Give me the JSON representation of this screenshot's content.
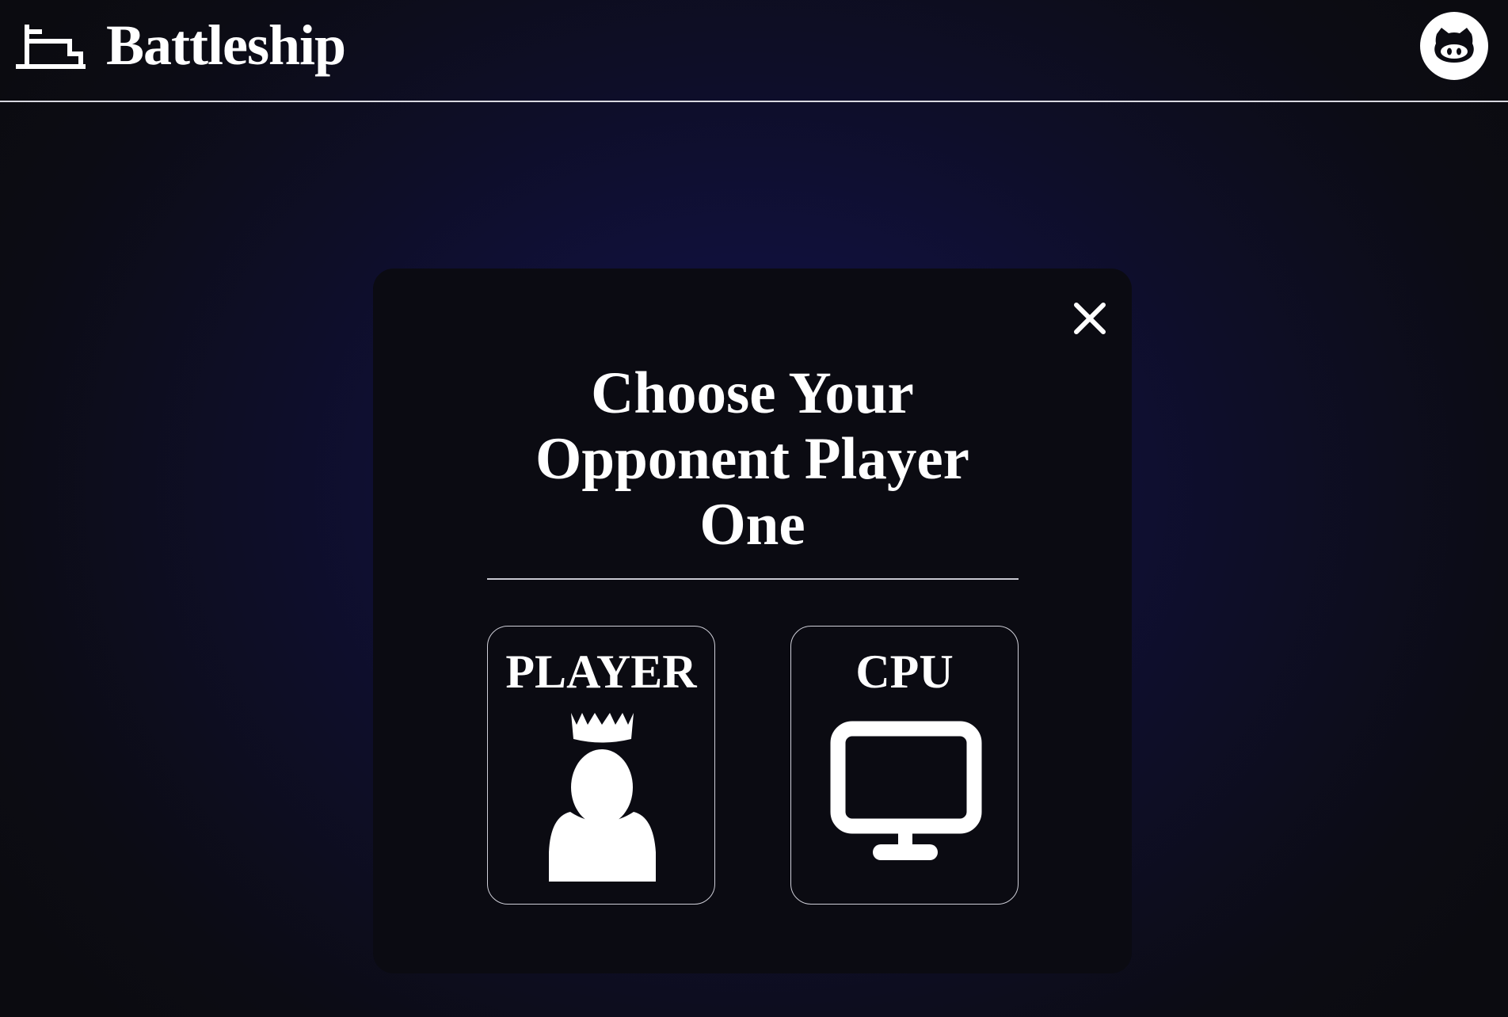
{
  "header": {
    "title": "Battleship",
    "logo_icon": "ship-icon",
    "github_icon": "github-icon"
  },
  "modal": {
    "title_lines": [
      "Choose Your",
      "Opponent Player",
      "One"
    ],
    "close_icon": "close-icon",
    "options": [
      {
        "label": "PLAYER",
        "icon": "crowned-person-icon"
      },
      {
        "label": "CPU",
        "icon": "monitor-icon"
      }
    ]
  },
  "colors": {
    "background": "#10103a",
    "panel": "#0b0b12",
    "text": "#ffffff",
    "border": "#cfcfd8"
  }
}
